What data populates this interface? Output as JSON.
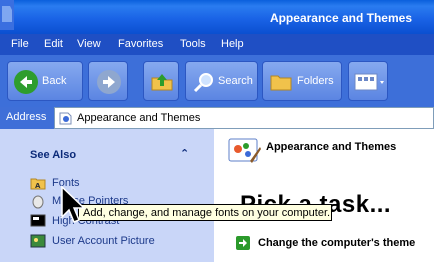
{
  "window": {
    "title": "Appearance and Themes"
  },
  "menu": [
    "File",
    "Edit",
    "View",
    "Favorites",
    "Tools",
    "Help"
  ],
  "toolbar": {
    "back_label": "Back",
    "search_label": "Search",
    "folders_label": "Folders"
  },
  "address": {
    "label": "Address",
    "value": "Appearance and Themes"
  },
  "see_also": {
    "title": "See Also",
    "collapse_glyph": "⌃",
    "items": [
      "Fonts",
      "Mouse Pointers",
      "High Contrast",
      "User Account Picture"
    ]
  },
  "main": {
    "title": "Appearance and Themes",
    "heading": "Pick a task...",
    "tasks": [
      "Change the computer's theme"
    ]
  },
  "tooltip": {
    "text": "Add, change, and manage fonts on your computer."
  }
}
